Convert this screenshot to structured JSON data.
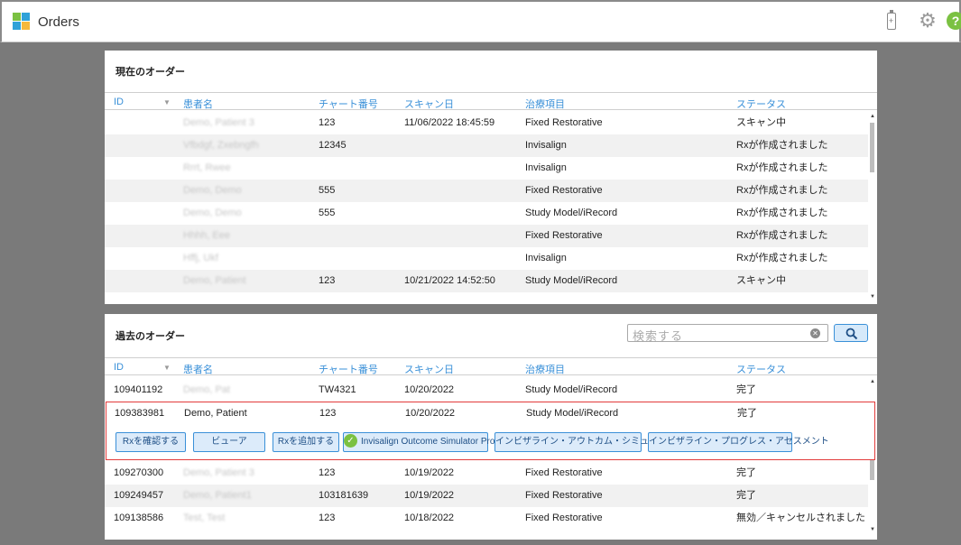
{
  "app": {
    "title": "Orders",
    "battery_glyph": "+",
    "gear_glyph": "⚙",
    "help_glyph": "?"
  },
  "columns": {
    "id": "ID",
    "name": "患者名",
    "chart": "チャート番号",
    "scan": "スキャン日",
    "treatment": "治療項目",
    "status": "ステータス",
    "sort_glyph": "▼"
  },
  "current": {
    "title": "現在のオーダー",
    "rows": [
      {
        "id": "",
        "name": "Demo, Patient 3",
        "chart": "123",
        "scan": "11/06/2022 18:45:59",
        "treatment": "Fixed Restorative",
        "status": "スキャン中"
      },
      {
        "id": "",
        "name": "Vfbdgf, Zxebngfh",
        "chart": "12345",
        "scan": "",
        "treatment": "Invisalign",
        "status": "Rxが作成されました"
      },
      {
        "id": "",
        "name": "Rrrt, Rwee",
        "chart": "",
        "scan": "",
        "treatment": "Invisalign",
        "status": "Rxが作成されました"
      },
      {
        "id": "",
        "name": "Demo, Demo",
        "chart": "555",
        "scan": "",
        "treatment": "Fixed Restorative",
        "status": "Rxが作成されました"
      },
      {
        "id": "",
        "name": "Demo, Demo",
        "chart": "555",
        "scan": "",
        "treatment": "Study Model/iRecord",
        "status": "Rxが作成されました"
      },
      {
        "id": "",
        "name": "Hhhh, Eee",
        "chart": "",
        "scan": "",
        "treatment": "Fixed Restorative",
        "status": "Rxが作成されました"
      },
      {
        "id": "",
        "name": "Hffj, Ukf",
        "chart": "",
        "scan": "",
        "treatment": "Invisalign",
        "status": "Rxが作成されました"
      },
      {
        "id": "",
        "name": "Demo, Patient",
        "chart": "123",
        "scan": "10/21/2022 14:52:50",
        "treatment": "Study Model/iRecord",
        "status": "スキャン中"
      }
    ]
  },
  "past": {
    "title": "過去のオーダー",
    "search_placeholder": "検索する",
    "clear_glyph": "✕",
    "rows": [
      {
        "id": "109401192",
        "name": "Demo, Pat",
        "chart": "TW4321",
        "scan": "10/20/2022",
        "treatment": "Study Model/iRecord",
        "status": "完了"
      },
      {
        "id": "109383981",
        "name": "Demo, Patient",
        "chart": "123",
        "scan": "10/20/2022",
        "treatment": "Study Model/iRecord",
        "status": "完了"
      },
      {
        "id": "109270300",
        "name": "Demo, Patient 3",
        "chart": "123",
        "scan": "10/19/2022",
        "treatment": "Fixed Restorative",
        "status": "完了"
      },
      {
        "id": "109249457",
        "name": "Demo, Patient1",
        "chart": "103181639",
        "scan": "10/19/2022",
        "treatment": "Fixed Restorative",
        "status": "完了"
      },
      {
        "id": "109138586",
        "name": "Test, Test",
        "chart": "123",
        "scan": "10/18/2022",
        "treatment": "Fixed Restorative",
        "status": "無効／キャンセルされました"
      }
    ],
    "actions": {
      "view_rx": "Rxを確認する",
      "viewer": "ビューア",
      "add_rx": "Rxを追加する",
      "outcome_sim_pro": "Invisalign Outcome Simulator Pro",
      "outcome_sim": "インビザライン・アウトカム・シミュレーター",
      "progress": "インビザライン・プログレス・アセスメント",
      "check_glyph": "✓"
    }
  },
  "colors": {
    "accent": "#3a90d8",
    "selection_border": "#e23b3b",
    "ok_green": "#7bc142"
  }
}
